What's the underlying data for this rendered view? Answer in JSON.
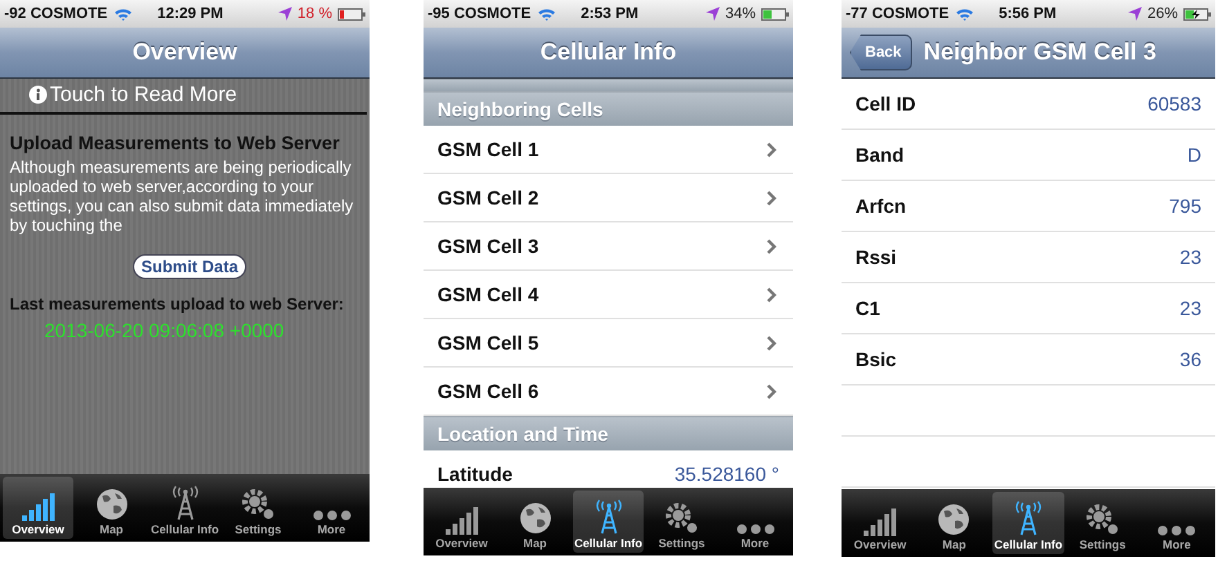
{
  "screens": [
    {
      "status_bar": {
        "carrier": "-92 COSMOTE",
        "time": "12:29 PM",
        "battery": "18 %",
        "low_battery": true,
        "charging": false
      },
      "nav_bar": {
        "title": "Overview"
      },
      "info_link": "Touch to Read More",
      "heading": "Upload Measurements to Web Server",
      "paragraph": "Although measurements are being periodically uploaded to web server,according to your settings, you can also submit data immediately by touching the",
      "submit_button": "Submit Data",
      "last_upload_label": "Last measurements upload to web Server:",
      "last_upload_time": "2013-06-20 09:06:08 +0000",
      "tab_bar": [
        {
          "label": "Overview",
          "selected": true
        },
        {
          "label": "Map",
          "selected": false
        },
        {
          "label": "Cellular Info",
          "selected": false
        },
        {
          "label": "Settings",
          "selected": false
        },
        {
          "label": "More",
          "selected": false
        }
      ]
    },
    {
      "status_bar": {
        "carrier": "-95 COSMOTE",
        "time": "2:53 PM",
        "battery": "34%",
        "low_battery": false,
        "charging": false
      },
      "nav_bar": {
        "title": "Cellular Info"
      },
      "sections": [
        {
          "header": "Neighboring Cells",
          "rows": [
            {
              "label": "GSM Cell 1"
            },
            {
              "label": "GSM Cell 2"
            },
            {
              "label": "GSM Cell 3"
            },
            {
              "label": "GSM Cell 4"
            },
            {
              "label": "GSM Cell 5"
            },
            {
              "label": "GSM Cell 6"
            }
          ]
        },
        {
          "header": "Location and Time",
          "rows": [
            {
              "label": "Latitude",
              "value": "35.528160 °"
            }
          ]
        }
      ],
      "tab_bar": [
        {
          "label": "Overview",
          "selected": false
        },
        {
          "label": "Map",
          "selected": false
        },
        {
          "label": "Cellular Info",
          "selected": true
        },
        {
          "label": "Settings",
          "selected": false
        },
        {
          "label": "More",
          "selected": false
        }
      ]
    },
    {
      "status_bar": {
        "carrier": "-77 COSMOTE",
        "time": "5:56 PM",
        "battery": "26%",
        "low_battery": false,
        "charging": true
      },
      "nav_bar": {
        "title": "Neighbor GSM Cell 3",
        "back_button": "Back"
      },
      "rows": [
        {
          "label": "Cell ID",
          "value": "60583"
        },
        {
          "label": "Band",
          "value": "D"
        },
        {
          "label": "Arfcn",
          "value": "795"
        },
        {
          "label": "Rssi",
          "value": "23"
        },
        {
          "label": "C1",
          "value": "23"
        },
        {
          "label": "Bsic",
          "value": "36"
        }
      ],
      "tab_bar": [
        {
          "label": "Overview",
          "selected": false
        },
        {
          "label": "Map",
          "selected": false
        },
        {
          "label": "Cellular Info",
          "selected": true
        },
        {
          "label": "Settings",
          "selected": false
        },
        {
          "label": "More",
          "selected": false
        }
      ]
    }
  ]
}
